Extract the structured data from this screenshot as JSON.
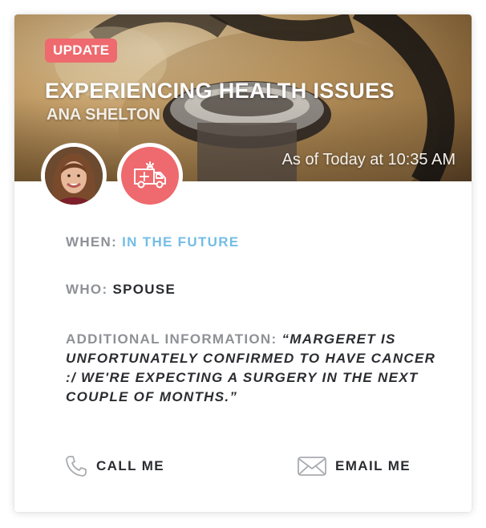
{
  "card": {
    "badge": "UPDATE",
    "title": "EXPERIENCING HEALTH ISSUES",
    "subtitle": "ANA SHELTON",
    "timestamp": "As of Today at 10:35 AM",
    "avatar_icon": "person-photo",
    "type_icon": "ambulance-icon"
  },
  "details": {
    "when_label": "WHEN:",
    "when_value": "IN THE FUTURE",
    "who_label": "WHO:",
    "who_value": "SPOUSE",
    "info_label": "ADDITIONAL INFORMATION:",
    "info_value": "“MARGERET IS UNFORTUNATELY CONFIRMED TO HAVE CANCER :/ WE'RE EXPECTING A SURGERY IN THE NEXT COUPLE OF MONTHS.”"
  },
  "actions": {
    "call_label": "CALL ME",
    "call_icon": "phone-icon",
    "email_label": "EMAIL ME",
    "email_icon": "envelope-icon"
  },
  "colors": {
    "accent_red": "#ee6a6e",
    "accent_blue": "#74bde6",
    "label_gray": "#8e9196",
    "text_dark": "#2b2c30"
  }
}
